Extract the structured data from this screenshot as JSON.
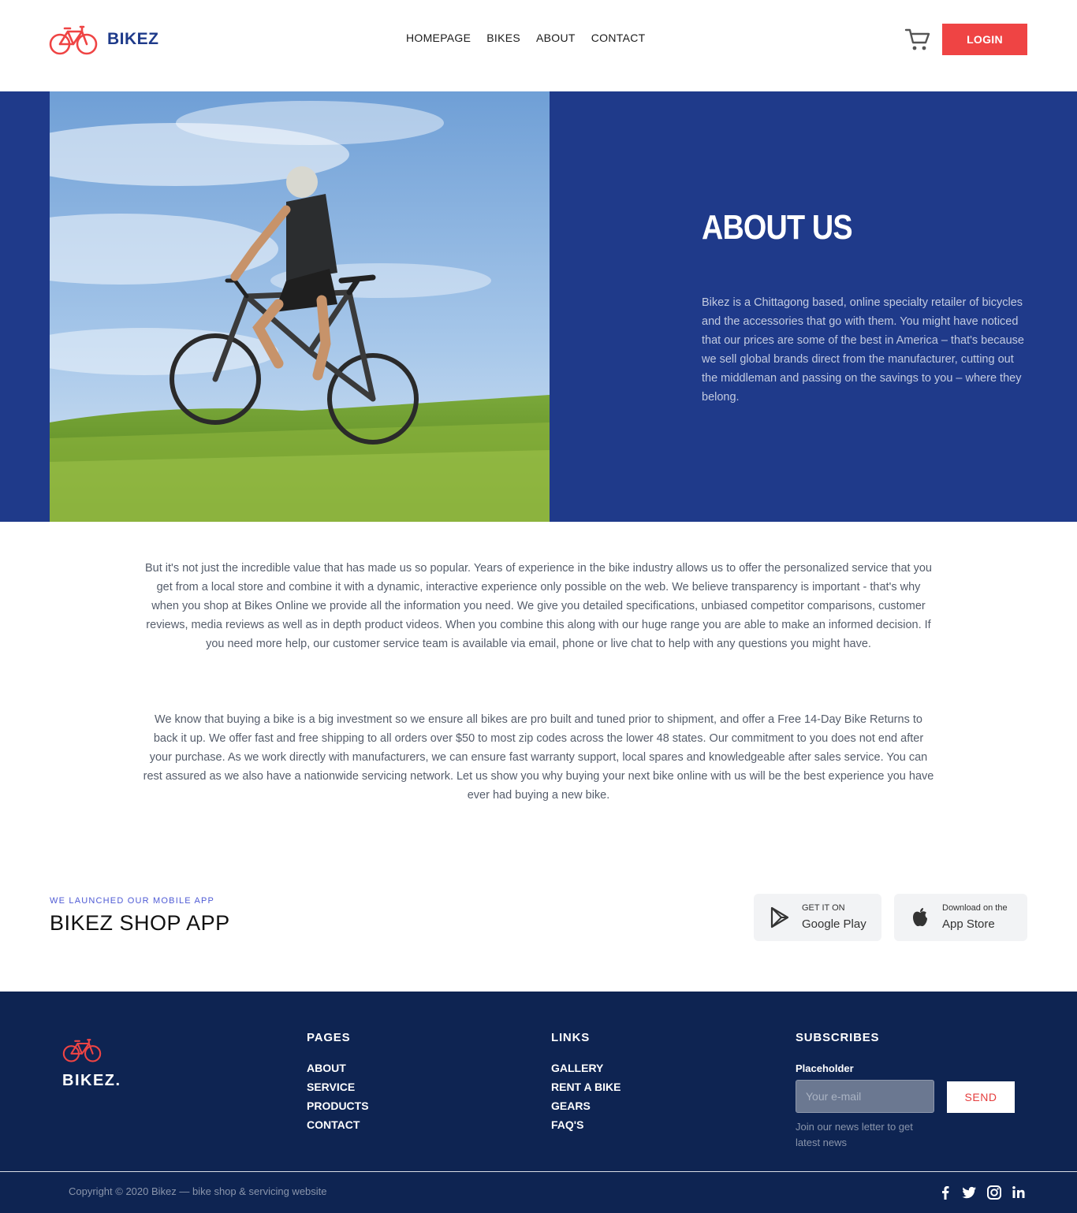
{
  "header": {
    "brand": "BIKEZ",
    "nav": [
      "HOMEPAGE",
      "BIKES",
      "ABOUT",
      "CONTACT"
    ],
    "login_label": "LOGIN"
  },
  "hero": {
    "title": "ABOUT US",
    "text": "Bikez is a Chittagong based, online specialty retailer of bicycles and the accessories that go with them. You might have noticed that our prices are some of the best in America – that's because we sell global brands direct from the manufacturer, cutting out the middleman and passing on the savings to you – where they belong."
  },
  "body": {
    "para1": "But it's not just the incredible value that has made us so popular. Years of experience in the bike industry allows us to offer the personalized service that you get from a local store and combine it with a dynamic, interactive experience only possible on the web. We believe transparency is important - that's why when you shop at Bikes Online we provide all the information you need. We give you detailed specifications, unbiased competitor comparisons, customer reviews, media reviews as well as in depth product videos. When you combine this along with our huge range you are able to make an informed decision. If you need more help, our customer service team is available via email, phone or live chat to help with any questions you might have.",
    "para2": "We know that buying a bike is a big investment so we ensure all bikes are pro built and tuned prior to shipment, and offer a Free 14-Day Bike Returns to back it up. We offer fast and free shipping to all orders over $50 to most zip codes across the lower 48 states. Our commitment to you does not end after your purchase. As we work directly with manufacturers, we can ensure fast warranty support, local spares and knowledgeable after sales service. You can rest assured as we also have a nationwide servicing network. Let us show you why buying your next bike online with us will be the best experience you have ever had buying a new bike."
  },
  "app": {
    "kicker": "WE LAUNCHED OUR MOBILE APP",
    "title": "BIKEZ SHOP APP",
    "google": {
      "small": "GET IT ON",
      "big": "Google Play"
    },
    "apple": {
      "small": "Download on the",
      "big": "App Store"
    }
  },
  "footer": {
    "brand": "BIKEZ.",
    "pages_title": "PAGES",
    "pages": [
      "ABOUT",
      "SERVICE",
      "PRODUCTS",
      "CONTACT"
    ],
    "links_title": "LINKS",
    "links": [
      "GALLERY",
      "RENT A BIKE",
      "GEARS",
      "FAQ'S"
    ],
    "subscribe_title": "SUBSCRIBES",
    "subscribe_label": "Placeholder",
    "email_placeholder": "Your e-mail",
    "send_label": "SEND",
    "note": "Join our news letter to get latest news",
    "copyright": "Copyright © 2020 Bikez — bike shop & servicing website"
  },
  "colors": {
    "brand_blue": "#1f3a8a",
    "accent_red": "#ef4444",
    "footer_bg": "#0e2452"
  },
  "icons": [
    "bicycle-icon",
    "cart-icon",
    "google-play-icon",
    "apple-icon",
    "facebook-icon",
    "twitter-icon",
    "instagram-icon",
    "linkedin-icon"
  ]
}
